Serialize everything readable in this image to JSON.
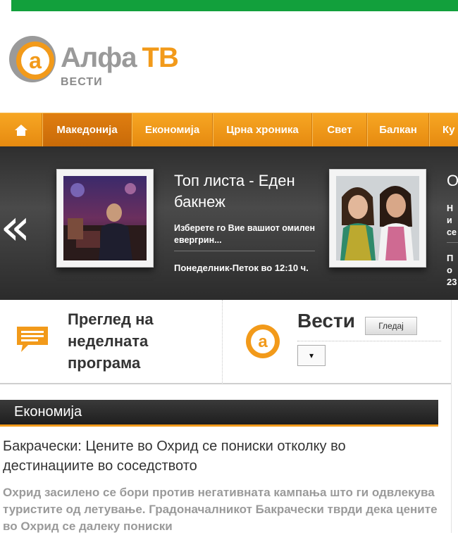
{
  "colors": {
    "accent": "#f29a1a",
    "top_bar": "#12a03c",
    "dark": "#2b2b2b"
  },
  "logo": {
    "name_part1": "Алфа",
    "name_part2": "ТВ",
    "subtitle": "ВЕСТИ",
    "icon_letter": "a"
  },
  "nav": {
    "home_icon": "home-icon",
    "items": [
      {
        "label": "Македонија",
        "active": true
      },
      {
        "label": "Економија"
      },
      {
        "label": "Црна хроника"
      },
      {
        "label": "Свет"
      },
      {
        "label": "Балкан"
      },
      {
        "label": "Ку"
      }
    ]
  },
  "slider": {
    "prev_icon": "double-chevron-left-icon",
    "slides": [
      {
        "title": "Топ листа - Еден бакнеж",
        "description": "Изберете го Вие вашиот омилен евергрин...",
        "time": "Понеделник-Петок во 12:10 ч."
      },
      {
        "title": "О",
        "description": "Ни се",
        "time": "По 23"
      }
    ]
  },
  "program_box": {
    "title": "Преглед на неделната програма",
    "icon": "message-icon"
  },
  "news_box": {
    "title": "Вести",
    "watch_button": "Гледај",
    "select_value": "▾"
  },
  "section": {
    "title": "Економија",
    "headline": "Бакрачески: Цените во Охрид се пониски отколку во дестинациите во соседството",
    "lead": "Охрид засилено се бори против негативната кампања што ги одвлекува туристите од летување. Градоначалникот Бакрачески тврди дека цените во Охрид се далеку пониски"
  }
}
